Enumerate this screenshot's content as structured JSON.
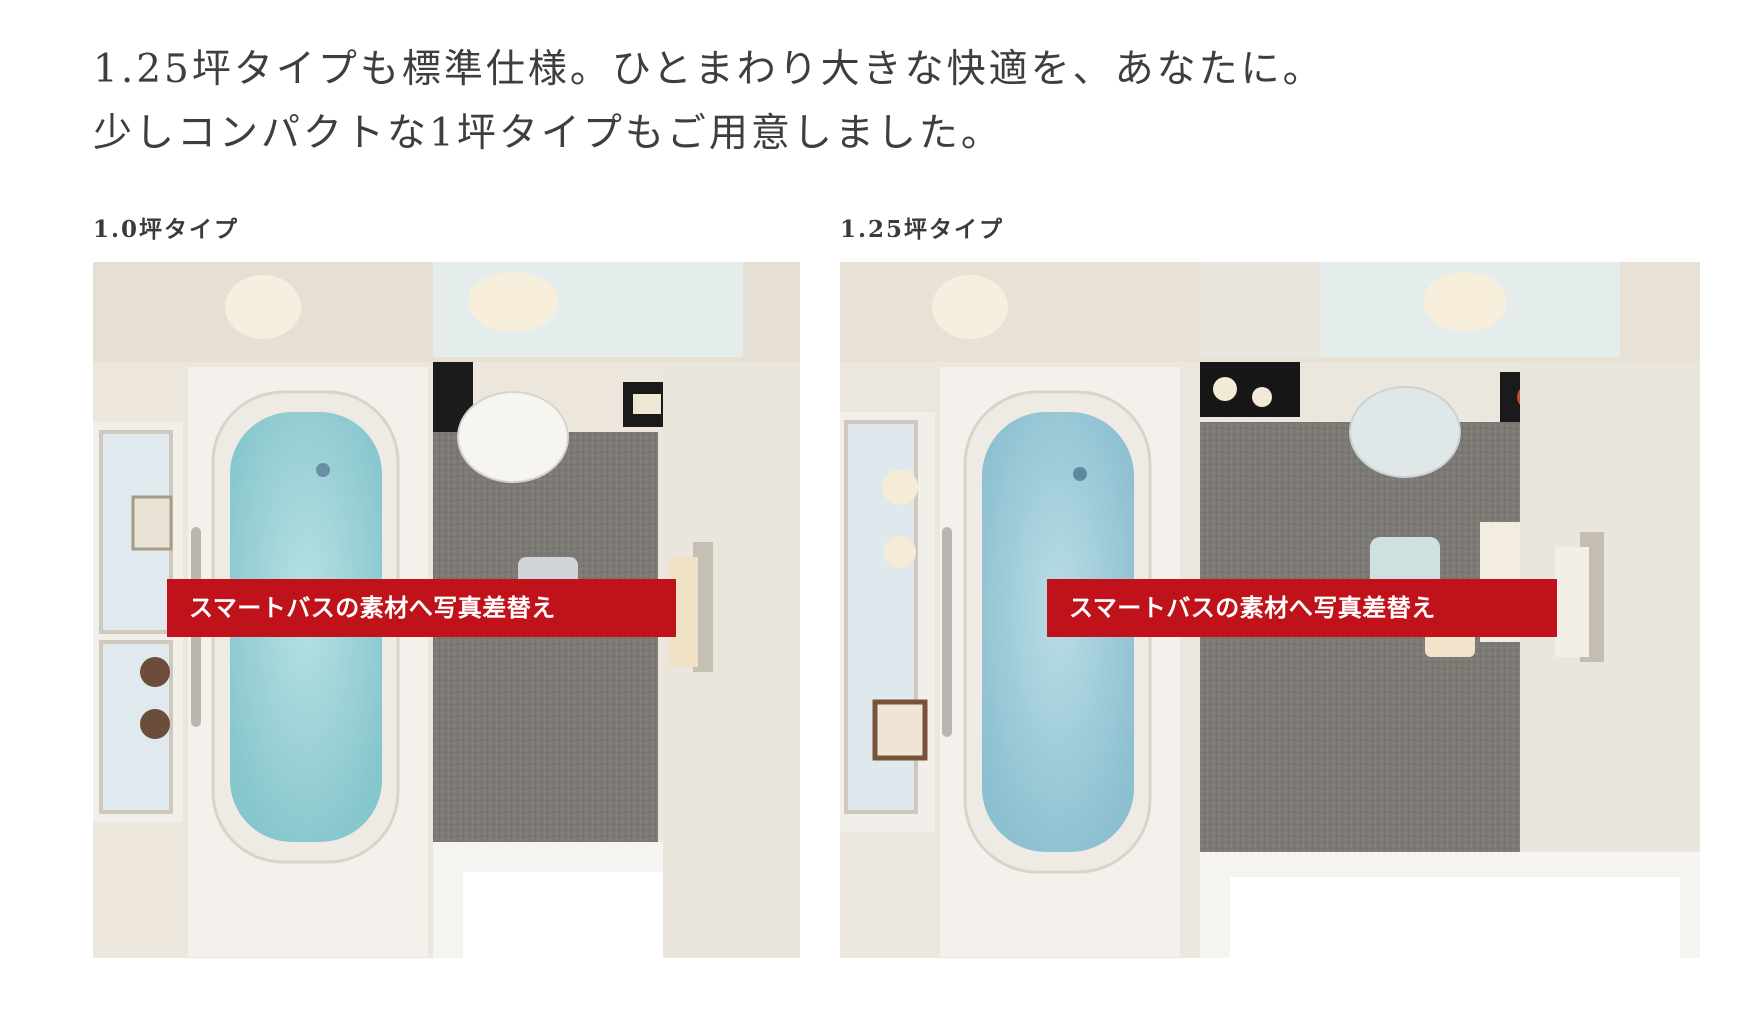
{
  "headline": {
    "line1": "1.25坪タイプも標準仕様。ひとまわり大きな快適を、あなたに。",
    "line2": "少しコンパクトな1坪タイプもご用意しました。"
  },
  "panels": [
    {
      "label": "1.0坪タイプ",
      "overlay_text": "スマートバスの素材へ写真差替え"
    },
    {
      "label": "1.25坪タイプ",
      "overlay_text": "スマートバスの素材へ写真差替え"
    }
  ],
  "colors": {
    "overlay_red": "#c0121a",
    "water": "#9fd3d8",
    "floor": "#7b7874"
  }
}
